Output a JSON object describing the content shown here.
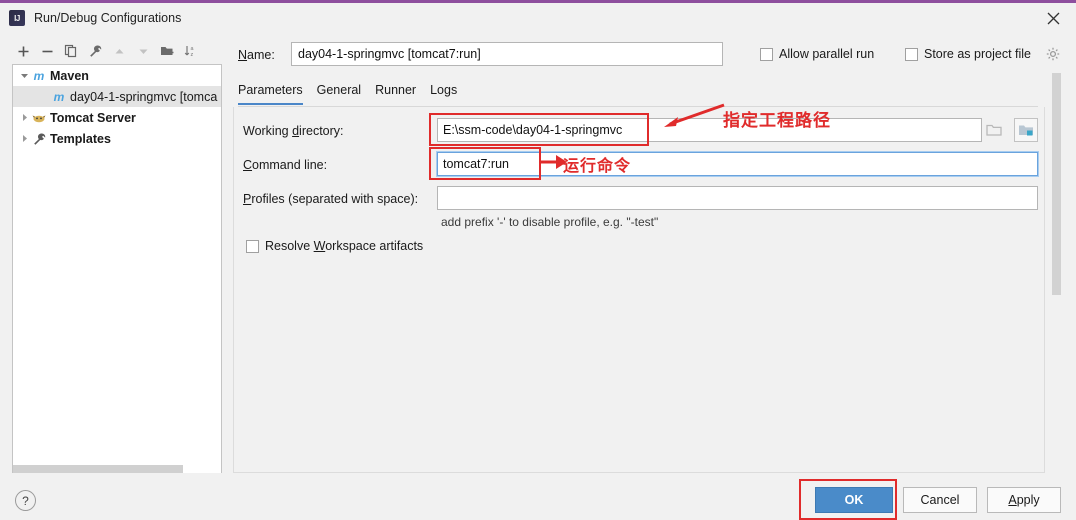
{
  "window": {
    "title": "Run/Debug Configurations",
    "logo_icon": "intellij-idea-logo-icon",
    "close_icon": "close-icon"
  },
  "left_toolbar": {
    "items": [
      {
        "name": "add-configuration-button",
        "icon": "plus-icon"
      },
      {
        "name": "remove-configuration-button",
        "icon": "minus-icon"
      },
      {
        "name": "copy-configuration-button",
        "icon": "copy-icon"
      },
      {
        "name": "edit-templates-button",
        "icon": "wrench-icon"
      },
      {
        "name": "move-up-button",
        "icon": "arrow-up-icon"
      },
      {
        "name": "move-down-button",
        "icon": "arrow-down-icon"
      },
      {
        "name": "new-folder-button",
        "icon": "folder-add-icon"
      },
      {
        "name": "sort-configurations-button",
        "icon": "sort-az-icon"
      }
    ]
  },
  "tree": {
    "items": [
      {
        "label": "Maven",
        "icon": "maven-icon",
        "expanded": true,
        "child": false,
        "selected": false
      },
      {
        "label": "day04-1-springmvc [tomca",
        "icon": "maven-icon",
        "expanded": null,
        "child": true,
        "selected": true
      },
      {
        "label": "Tomcat Server",
        "icon": "tomcat-icon",
        "expanded": false,
        "child": false,
        "selected": false
      },
      {
        "label": "Templates",
        "icon": "wrench-icon",
        "expanded": false,
        "child": false,
        "selected": false
      }
    ]
  },
  "help_button": {
    "label": "?",
    "icon": "help-icon"
  },
  "form": {
    "name_label": "Name:",
    "name_value": "day04-1-springmvc [tomcat7:run]",
    "allow_parallel_run_label": "Allow parallel run",
    "allow_parallel_run_checked": false,
    "store_as_project_file_label": "Store as project file",
    "store_as_project_file_checked": false,
    "gear_icon": "gear-icon"
  },
  "tabs": [
    {
      "label": "Parameters",
      "active": true
    },
    {
      "label": "General",
      "active": false
    },
    {
      "label": "Runner",
      "active": false
    },
    {
      "label": "Logs",
      "active": false
    }
  ],
  "parameters": {
    "working_directory_label": "Working directory:",
    "working_directory_value": "E:\\ssm-code\\day04-1-springmvc",
    "command_line_label": "Command line:",
    "command_line_value": "tomcat7:run",
    "profiles_label": "Profiles (separated with space):",
    "profiles_value": "",
    "profiles_hint": "add prefix '-' to disable profile, e.g. \"-test\"",
    "resolve_workspace_artifacts_label": "Resolve Workspace artifacts",
    "resolve_workspace_artifacts_checked": false,
    "browse_icon_1": "folder-browse-icon",
    "browse_icon_2": "folder-macro-icon"
  },
  "buttons": {
    "ok": "OK",
    "cancel": "Cancel",
    "apply": "Apply"
  },
  "annotations": {
    "working_directory_note": "指定工程路径",
    "command_line_note": "运行命令",
    "color": "#e02b2b"
  },
  "colors": {
    "accent_blue": "#4a8bc9",
    "tab_underline": "#4a86c8",
    "window_bg": "#f1f1f1",
    "title_border": "#8e4f9e",
    "annotation_red": "#e02b2b"
  }
}
